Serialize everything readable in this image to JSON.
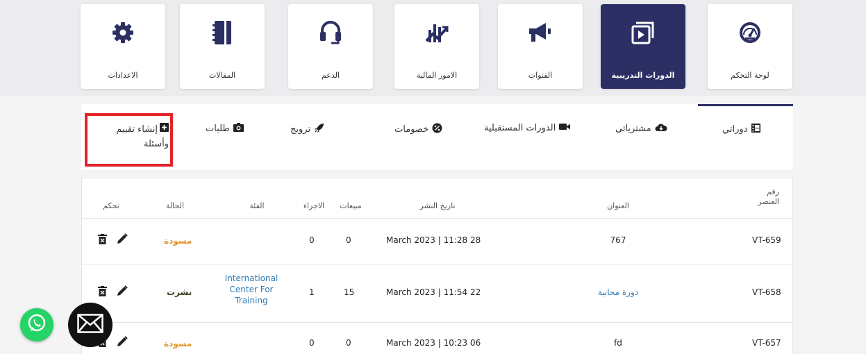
{
  "top_menu": [
    {
      "label": "الاعدادات",
      "icon": "gear-icon",
      "active": false
    },
    {
      "label": "المقالات",
      "icon": "notebook-icon",
      "active": false
    },
    {
      "label": "الدعم",
      "icon": "headset-icon",
      "active": false
    },
    {
      "label": "الامور المالية",
      "icon": "finance-chart-icon",
      "active": false
    },
    {
      "label": "القنوات",
      "icon": "megaphone-icon",
      "active": false
    },
    {
      "label": "الدورات التدريبية",
      "icon": "play-video-icon",
      "active": true
    },
    {
      "label": "لوحة التحكم",
      "icon": "dashboard-gauge-icon",
      "active": false
    }
  ],
  "tabs": {
    "create": "إنشاء تقييم وأسئلة",
    "requests": "طلبات",
    "promote": "ترويج",
    "discounts": "خصومات",
    "upcoming": "الدورات المستقبلية",
    "purchases": "مشترياتي",
    "my_courses": "دوراتي"
  },
  "table": {
    "headers": {
      "id": "رقم العنصر",
      "title": "العنوان",
      "publish_date": "تاريخ النشر",
      "sales": "مبيعات",
      "parts": "الاجزاء",
      "category": "الفئة",
      "status": "الحالة",
      "control": "تحكم"
    },
    "rows": [
      {
        "id": "VT-659",
        "title": "767",
        "date": "March 2023 | 11:28 28",
        "sales": "0",
        "parts": "0",
        "category": "",
        "status": "مسودة"
      },
      {
        "id": "VT-658",
        "title": "دورة مجانية",
        "date": "March 2023 | 11:54 22",
        "sales": "15",
        "parts": "1",
        "category": "International Center For Training",
        "status": "نشرت"
      },
      {
        "id": "VT-657",
        "title": "fd",
        "date": "March 2023 | 10:23 06",
        "sales": "0",
        "parts": "0",
        "category": "",
        "status": "مسودة"
      }
    ]
  },
  "colors": {
    "primary": "#2b2f63",
    "highlight": "#e12429",
    "draft": "#e0952b",
    "link": "#2e7bb8",
    "whatsapp": "#25d366"
  }
}
